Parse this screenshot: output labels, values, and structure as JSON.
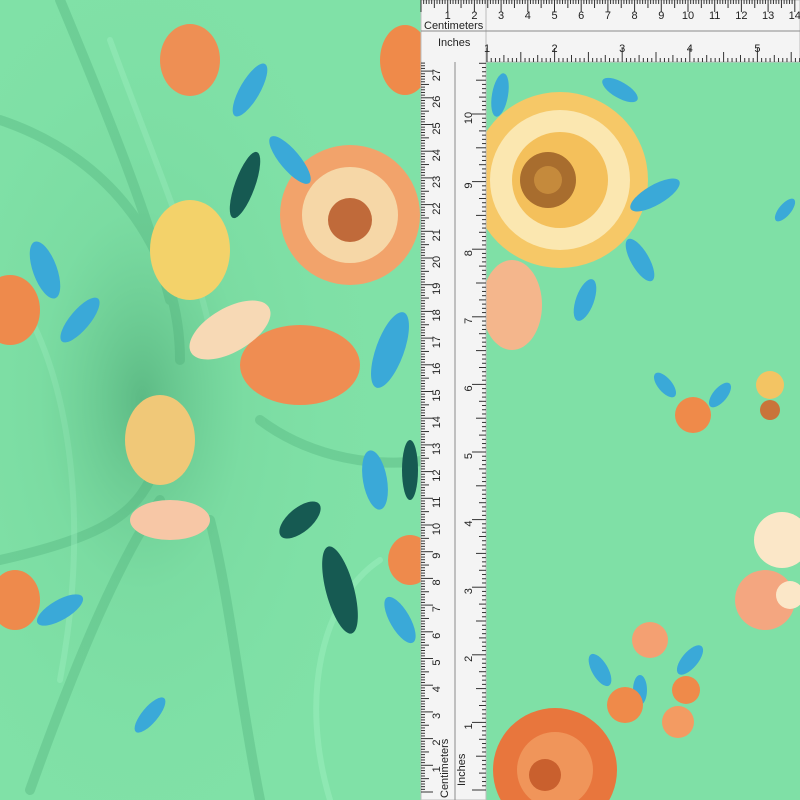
{
  "product": {
    "description": "mint green floral knit fabric with a twisted swatch and a measurement ruler overlay",
    "colors": {
      "background": "#7fe0a6",
      "ruler": "#f4f4f4",
      "flower_orange": "#ef8a4a",
      "flower_yellow": "#f3d26a",
      "leaf_blue": "#3aa9d8",
      "leaf_teal": "#165a52"
    }
  },
  "ruler": {
    "top_cm_label": "Centimeters",
    "top_in_label": "Inches",
    "left_cm_label": "Centimeters",
    "left_in_label": "Inches",
    "top_cm_ticks": [
      "1",
      "2",
      "3",
      "4",
      "5",
      "6",
      "7",
      "8",
      "9",
      "10",
      "11",
      "12",
      "13",
      "14"
    ],
    "top_in_ticks": [
      "1",
      "2",
      "3",
      "4",
      "5"
    ],
    "left_cm_ticks": [
      "1",
      "2",
      "3",
      "4",
      "5",
      "6",
      "7",
      "8",
      "9",
      "10",
      "11",
      "12",
      "13",
      "14",
      "15",
      "16",
      "17",
      "18",
      "19",
      "20",
      "21",
      "22",
      "23",
      "24",
      "25",
      "26",
      "27"
    ],
    "left_in_ticks": [
      "1",
      "2",
      "3",
      "4",
      "5",
      "6",
      "7",
      "8",
      "9",
      "10"
    ]
  }
}
